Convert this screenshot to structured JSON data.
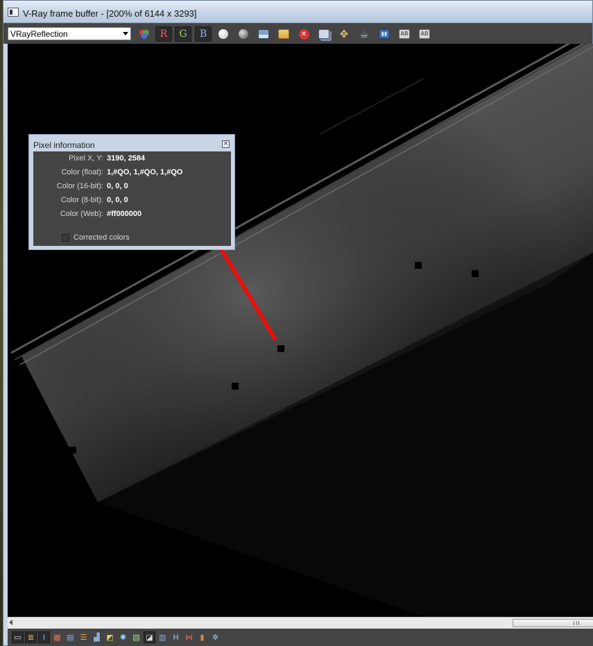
{
  "window": {
    "title": "V-Ray frame buffer - [200% of 6144 x 3293]"
  },
  "toolbar": {
    "channel_select": "VRayReflection",
    "buttons": [
      {
        "name": "color-mode-icon",
        "kind": "rgb"
      },
      {
        "name": "red-channel-button",
        "kind": "letter",
        "label": "R",
        "color": "#ff5a5a",
        "pressed": true
      },
      {
        "name": "green-channel-button",
        "kind": "letter",
        "label": "G",
        "color": "#9fd36b",
        "pressed": true
      },
      {
        "name": "blue-channel-button",
        "kind": "letter",
        "label": "B",
        "color": "#8fb7ff",
        "pressed": true
      },
      {
        "name": "mono-mode-icon",
        "kind": "white-sphere"
      },
      {
        "name": "alpha-mode-icon",
        "kind": "gray-sphere"
      },
      {
        "name": "save-image-icon",
        "kind": "save"
      },
      {
        "name": "load-image-icon",
        "kind": "folder"
      },
      {
        "name": "clear-image-icon",
        "kind": "clear"
      },
      {
        "name": "duplicate-to-max-icon",
        "kind": "duplicate"
      },
      {
        "name": "track-mouse-icon",
        "kind": "crosshair"
      },
      {
        "name": "render-teapot-icon",
        "kind": "teapot"
      },
      {
        "name": "lens-effects-icon",
        "kind": "blue-box"
      },
      {
        "name": "region-render-icon",
        "kind": "ab"
      },
      {
        "name": "link-to-viewport-icon",
        "kind": "ab2"
      }
    ]
  },
  "pixel_info": {
    "title": "Pixel information",
    "rows": [
      {
        "label": "Pixel X, Y:",
        "value": "3190, 2584"
      },
      {
        "label": "Color (float):",
        "value": "1,#QO, 1,#QO, 1,#QO"
      },
      {
        "label": "Color (16-bit):",
        "value": "0, 0, 0"
      },
      {
        "label": "Color (8-bit):",
        "value": "0, 0, 0"
      },
      {
        "label": "Color (Web):",
        "value": "#ff000000"
      }
    ],
    "corrected_colors_label": "Corrected colors",
    "corrected_colors_checked": false
  },
  "bottom_toolbar": {
    "buttons": [
      {
        "name": "display-window-icon",
        "glyph": "▭",
        "pressed": true
      },
      {
        "name": "history-icon",
        "glyph": "≣",
        "pressed": true
      },
      {
        "name": "info-icon",
        "glyph": "i",
        "pressed": true
      },
      {
        "name": "color-corrections-icon",
        "glyph": "▦"
      },
      {
        "name": "levels-icon",
        "glyph": "▤"
      },
      {
        "name": "curves-list-icon",
        "glyph": "☰"
      },
      {
        "name": "histogram-icon",
        "glyph": "▟"
      },
      {
        "name": "exposure-icon",
        "glyph": "◩"
      },
      {
        "name": "lut-icon",
        "glyph": "✺"
      },
      {
        "name": "background-image-icon",
        "glyph": "▧"
      },
      {
        "name": "ocio-icon",
        "glyph": "◪",
        "pressed": true
      },
      {
        "name": "srgb-icon",
        "glyph": "▥"
      },
      {
        "name": "h-button-icon",
        "glyph": "H"
      },
      {
        "name": "compare-icon",
        "glyph": "⋈"
      },
      {
        "name": "stereo-icon",
        "glyph": "▮"
      },
      {
        "name": "lens-icon",
        "glyph": "✲"
      }
    ]
  },
  "annotation": {
    "pointer_color": "#e8100c",
    "markers": [
      "marker-1",
      "marker-2",
      "marker-3",
      "marker-4",
      "marker-5"
    ]
  }
}
